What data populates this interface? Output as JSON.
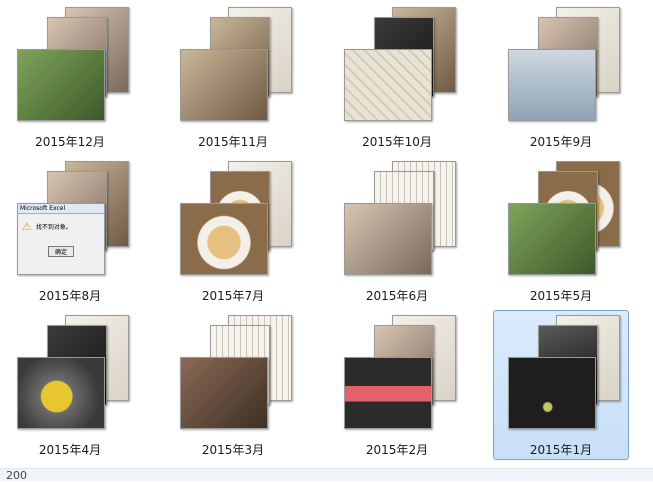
{
  "folders": [
    {
      "label": "2015年12月",
      "selected": false,
      "thumbs": [
        "t-face",
        "t-face",
        "t-green"
      ]
    },
    {
      "label": "2015年11月",
      "selected": false,
      "thumbs": [
        "t-paper",
        "t-indoor",
        "t-indoor"
      ]
    },
    {
      "label": "2015年10月",
      "selected": false,
      "thumbs": [
        "t-indoor",
        "t-dark",
        "t-map"
      ]
    },
    {
      "label": "2015年9月",
      "selected": false,
      "thumbs": [
        "t-paper",
        "t-face",
        "t-sky"
      ]
    },
    {
      "label": "2015年8月",
      "selected": false,
      "thumbs": [
        "t-indoor",
        "t-face",
        "t-excel"
      ]
    },
    {
      "label": "2015年7月",
      "selected": false,
      "thumbs": [
        "t-paper",
        "t-food",
        "t-food"
      ]
    },
    {
      "label": "2015年6月",
      "selected": false,
      "thumbs": [
        "t-text",
        "t-text",
        "t-face"
      ]
    },
    {
      "label": "2015年5月",
      "selected": false,
      "thumbs": [
        "t-food",
        "t-food",
        "t-green"
      ]
    },
    {
      "label": "2015年4月",
      "selected": false,
      "thumbs": [
        "t-paper",
        "t-dark",
        "t-yellow"
      ]
    },
    {
      "label": "2015年3月",
      "selected": false,
      "thumbs": [
        "t-text",
        "t-text",
        "t-people"
      ]
    },
    {
      "label": "2015年2月",
      "selected": false,
      "thumbs": [
        "t-paper",
        "t-face",
        "t-card"
      ]
    },
    {
      "label": "2015年1月",
      "selected": true,
      "thumbs": [
        "t-paper",
        "t-desk",
        "t-pen"
      ]
    }
  ],
  "excel_dialog": {
    "title": "Microsoft Excel",
    "message": "找不到对象。",
    "button": "确定"
  },
  "status": {
    "text": "200"
  },
  "colors": {
    "selection_bg": "#cfe3fa",
    "selection_border": "#7da2ce"
  }
}
